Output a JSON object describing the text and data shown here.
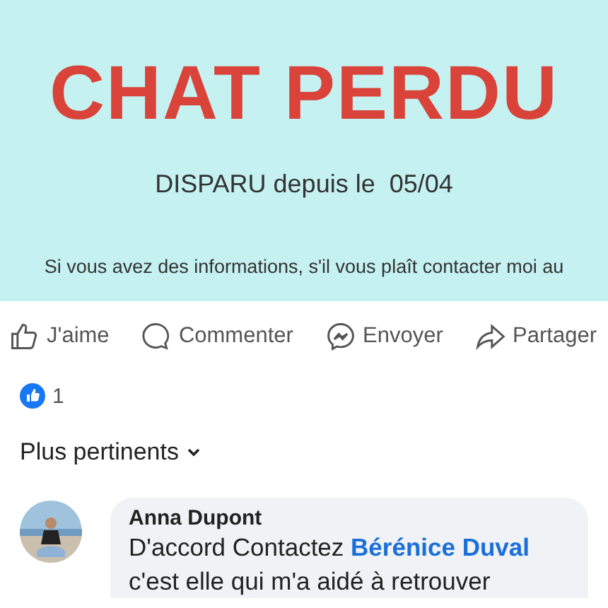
{
  "poster": {
    "title": "CHAT PERDU",
    "subtitle": "DISPARU depuis le  05/04",
    "info": "Si vous avez des informations, s'il vous plaît contacter moi au"
  },
  "actions": [
    {
      "kind": "like",
      "label": "J'aime"
    },
    {
      "kind": "comment",
      "label": "Commenter"
    },
    {
      "kind": "send",
      "label": "Envoyer"
    },
    {
      "kind": "share",
      "label": "Partager"
    }
  ],
  "reactions": {
    "count": "1"
  },
  "sort": {
    "label": "Plus pertinents"
  },
  "comments": [
    {
      "author": "Anna Dupont",
      "text": "D'accord Contactez **Bérénice Duval**",
      "continuation": "c'est elle qui m'a aidé à retrouver"
    }
  ]
}
